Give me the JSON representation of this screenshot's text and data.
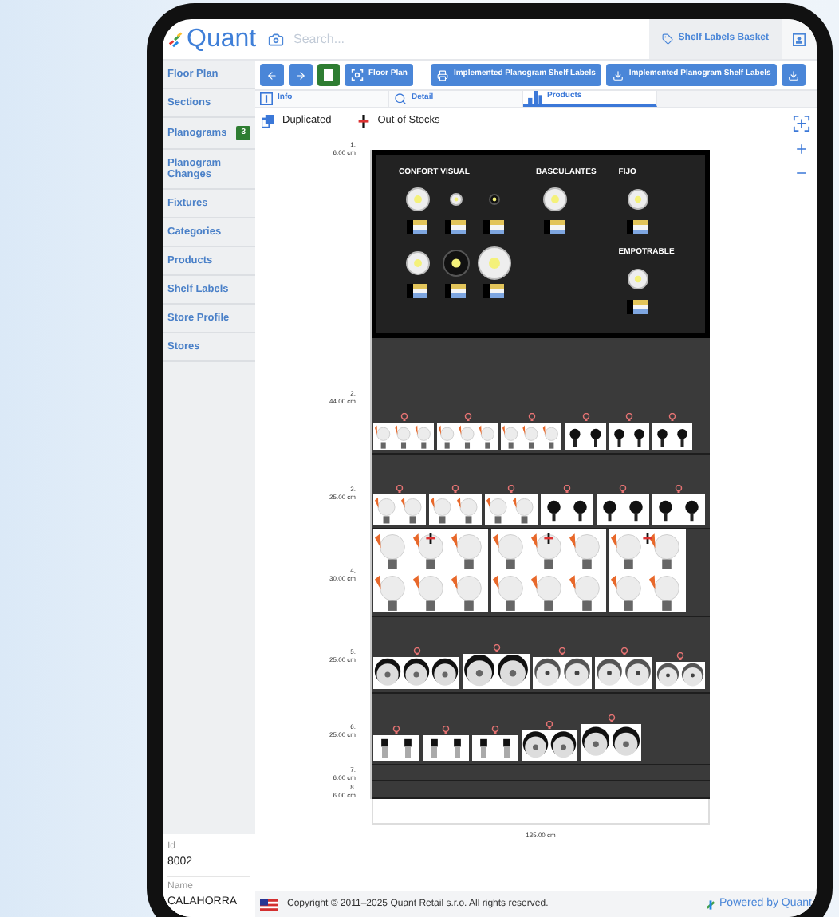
{
  "header": {
    "logo": "Quant",
    "search": {
      "placeholder": "Search..."
    },
    "basket_button": "Shelf Labels Basket"
  },
  "sidebar": {
    "items": [
      {
        "label": "Floor Plan"
      },
      {
        "label": "Sections"
      },
      {
        "label": "Planograms",
        "badge": "3"
      },
      {
        "label": "Planogram Changes"
      },
      {
        "label": "Fixtures"
      },
      {
        "label": "Categories"
      },
      {
        "label": "Products"
      },
      {
        "label": "Shelf Labels"
      },
      {
        "label": "Store Profile"
      },
      {
        "label": "Stores"
      }
    ],
    "store": {
      "id_label": "Id",
      "id": "8002",
      "name_label": "Name",
      "name": "CALAHORRA"
    }
  },
  "toolbar": {
    "floor_plan_button": "Floor Plan",
    "print_button": "Implemented Planogram Shelf Labels",
    "download_button": "Implemented Planogram Shelf Labels"
  },
  "tabs": [
    {
      "label": "Info",
      "selected": false
    },
    {
      "label": "Detail",
      "selected": false
    },
    {
      "label": "Products",
      "selected": true
    }
  ],
  "legend": [
    {
      "kind": "duplicated",
      "label": "Duplicated"
    },
    {
      "kind": "out_of_stock",
      "label": "Out of Stocks"
    }
  ],
  "planogram": {
    "shelves": [
      {
        "kind": "panel",
        "number": "1.",
        "height": "6.00 cm",
        "columns": [
          {
            "titles": [
              "CONFORT VISUAL"
            ]
          },
          {
            "titles": [
              "BASCULANTES"
            ]
          },
          {
            "titles": [
              "FIJO",
              "EMPOTRABLE"
            ]
          }
        ]
      },
      {
        "kind": "shelf",
        "number": "2.",
        "height": "44.00 cm"
      },
      {
        "kind": "shelf",
        "number": "3.",
        "height": "25.00 cm"
      },
      {
        "kind": "shelf",
        "number": "4.",
        "height": "30.00 cm"
      },
      {
        "kind": "shelf",
        "number": "5.",
        "height": "25.00 cm"
      },
      {
        "kind": "shelf",
        "number": "6.",
        "height": "25.00 cm"
      },
      {
        "kind": "shelf",
        "number": "7.",
        "height": "6.00 cm"
      },
      {
        "kind": "shelf",
        "number": "8.",
        "height": "6.00 cm"
      }
    ],
    "width": "135.00 cm"
  },
  "footer": {
    "copyright": "Copyright © 2011–2025 Quant Retail s.r.o. All rights reserved.",
    "powered_by": "Powered by Quant"
  }
}
